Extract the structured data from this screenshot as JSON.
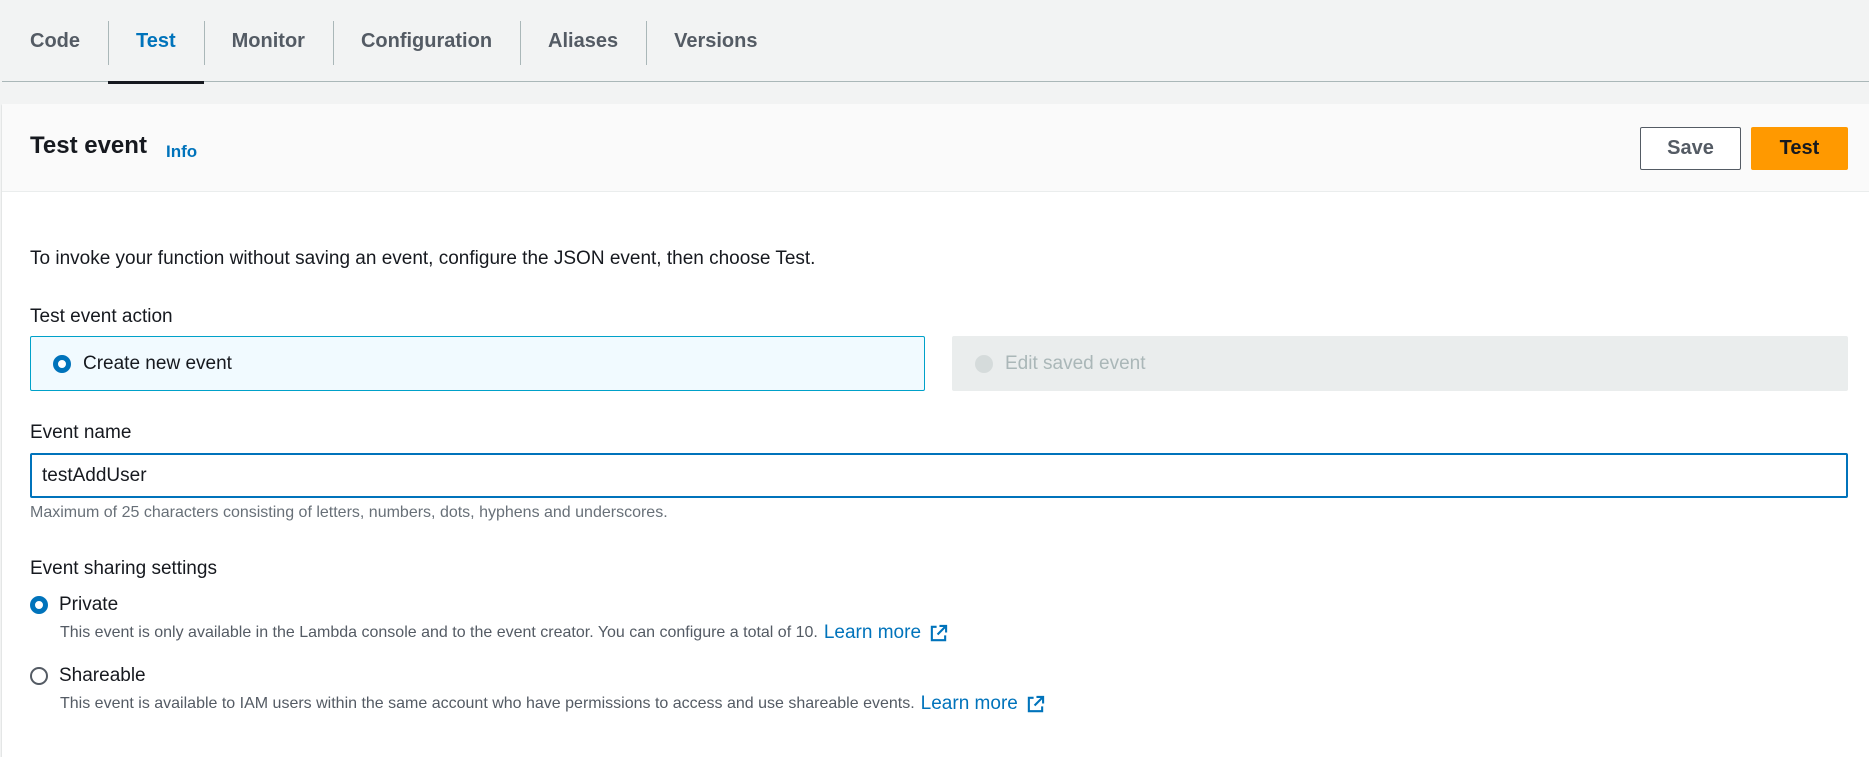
{
  "tabs": [
    {
      "label": "Code",
      "active": false
    },
    {
      "label": "Test",
      "active": true
    },
    {
      "label": "Monitor",
      "active": false
    },
    {
      "label": "Configuration",
      "active": false
    },
    {
      "label": "Aliases",
      "active": false
    },
    {
      "label": "Versions",
      "active": false
    }
  ],
  "panel": {
    "title": "Test event",
    "info": "Info",
    "save_label": "Save",
    "test_label": "Test",
    "description": "To invoke your function without saving an event, configure the JSON event, then choose Test."
  },
  "action": {
    "label": "Test event action",
    "create": "Create new event",
    "edit": "Edit saved event",
    "selected": "create"
  },
  "event_name": {
    "label": "Event name",
    "value": "testAddUser",
    "hint": "Maximum of 25 characters consisting of letters, numbers, dots, hyphens and underscores."
  },
  "sharing": {
    "label": "Event sharing settings",
    "private_label": "Private",
    "private_desc": "This event is only available in the Lambda console and to the event creator. You can configure a total of 10.",
    "shareable_label": "Shareable",
    "shareable_desc": "This event is available to IAM users within the same account who have permissions to access and use shareable events.",
    "learn_more": "Learn more",
    "selected": "private"
  },
  "colors": {
    "accent": "#0073bb",
    "primary_button": "#ff9900",
    "background": "#f2f3f3"
  }
}
